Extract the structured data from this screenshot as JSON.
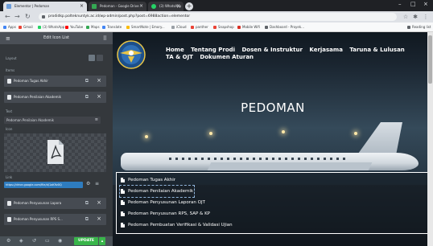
{
  "browser": {
    "tabs": [
      {
        "label": "Elementor | Pedoman",
        "color": "#6d9edb"
      },
      {
        "label": "Pedoman - Google Drive",
        "color": "#34a853"
      },
      {
        "label": "(3) WhatsApp",
        "color": "#25d366"
      }
    ],
    "new_tab_symbol": "+",
    "window_controls": [
      "–",
      "□",
      "×"
    ],
    "url": "prodidkp.polteknuntyk.ac.id/wp-admin/post.php?post=6988action=elementor",
    "bookmarks": [
      {
        "label": "Apps",
        "color": "#4285f4"
      },
      {
        "label": "Gmail",
        "color": "#ea4335"
      },
      {
        "label": "(3) WhatsApp",
        "color": "#25d366"
      },
      {
        "label": "YouTube",
        "color": "#ff0000"
      },
      {
        "label": "Maps",
        "color": "#34a853"
      },
      {
        "label": "Translate",
        "color": "#4285f4"
      },
      {
        "label": "SmartNote | Emory...",
        "color": "#fbbc05"
      },
      {
        "label": "iCloud",
        "color": "#9aa0a6"
      },
      {
        "label": "panther",
        "color": "#ea4335"
      },
      {
        "label": "Snapshop",
        "color": "#ea4335"
      },
      {
        "label": "Mobile Wifi",
        "color": "#d93025"
      },
      {
        "label": "Dashboard - Proyek...",
        "color": "#5f6368"
      }
    ],
    "reading_list": "Reading list"
  },
  "panel": {
    "title": "Edit Icon List",
    "layout_label": "Layout",
    "items_label": "Items",
    "items": [
      {
        "label": "Pedoman Tugas Akhir"
      },
      {
        "label": "Pedoman Penilaian Akademik"
      }
    ],
    "text_label": "Text",
    "text_value": "Pedoman Penilaian Akademik",
    "icon_label": "Icon",
    "link_label": "Link",
    "link_value": "https://drive.google.com/file/d/1aK9z0Q",
    "items_below": [
      {
        "label": "Pedoman Penyusunan Lapora"
      },
      {
        "label": "Pedoman Penyusunan RPS S..."
      }
    ],
    "update_label": "UPDATE"
  },
  "site": {
    "nav_row1": [
      "Home",
      "Tentang Prodi",
      "Dosen & Instruktur",
      "Kerjasama",
      "Taruna & Lulusan"
    ],
    "nav_row2": [
      "TA & OJT",
      "Dokumen Aturan"
    ],
    "hero_title": "PEDOMAN",
    "documents": [
      "Pedoman Tugas Akhir",
      "Pedoman Penilaian Akademik",
      "Pedoman Penyusunan Laporan OJT",
      "Pedoman Penyusunan RPS, SAP & KP",
      "Pedoman Pembuatan Verifikasi & Validasi Ujian"
    ]
  },
  "colors": {
    "panel_bg": "#34383c",
    "update_green": "#39b54a",
    "link_blue": "#2e7cbf"
  }
}
